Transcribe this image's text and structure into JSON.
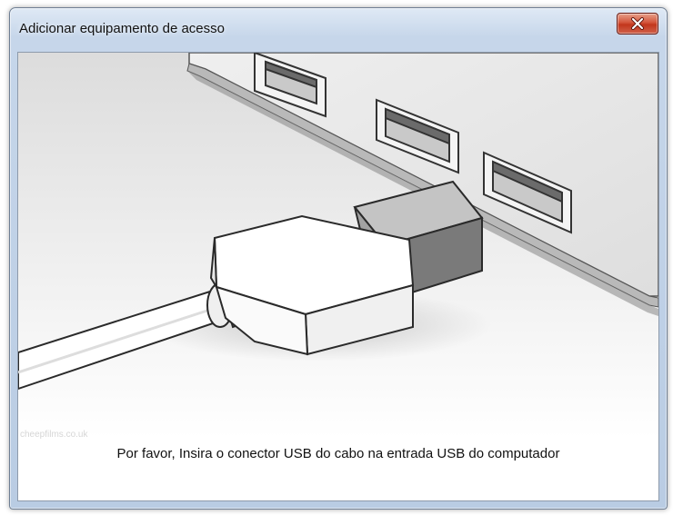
{
  "window": {
    "title": "Adicionar equipamento de acesso"
  },
  "titlebar": {
    "close_icon": "close-x-icon"
  },
  "content": {
    "illustration": "usb-plug-into-laptop-port-illustration",
    "watermark": "cheepfilms.co.uk",
    "instruction": "Por favor, Insira o conector USB do cabo na entrada USB do computador"
  },
  "colors": {
    "close_button": "#c9452c",
    "frame": "#c6d6ea",
    "client_background": "#ffffff"
  }
}
